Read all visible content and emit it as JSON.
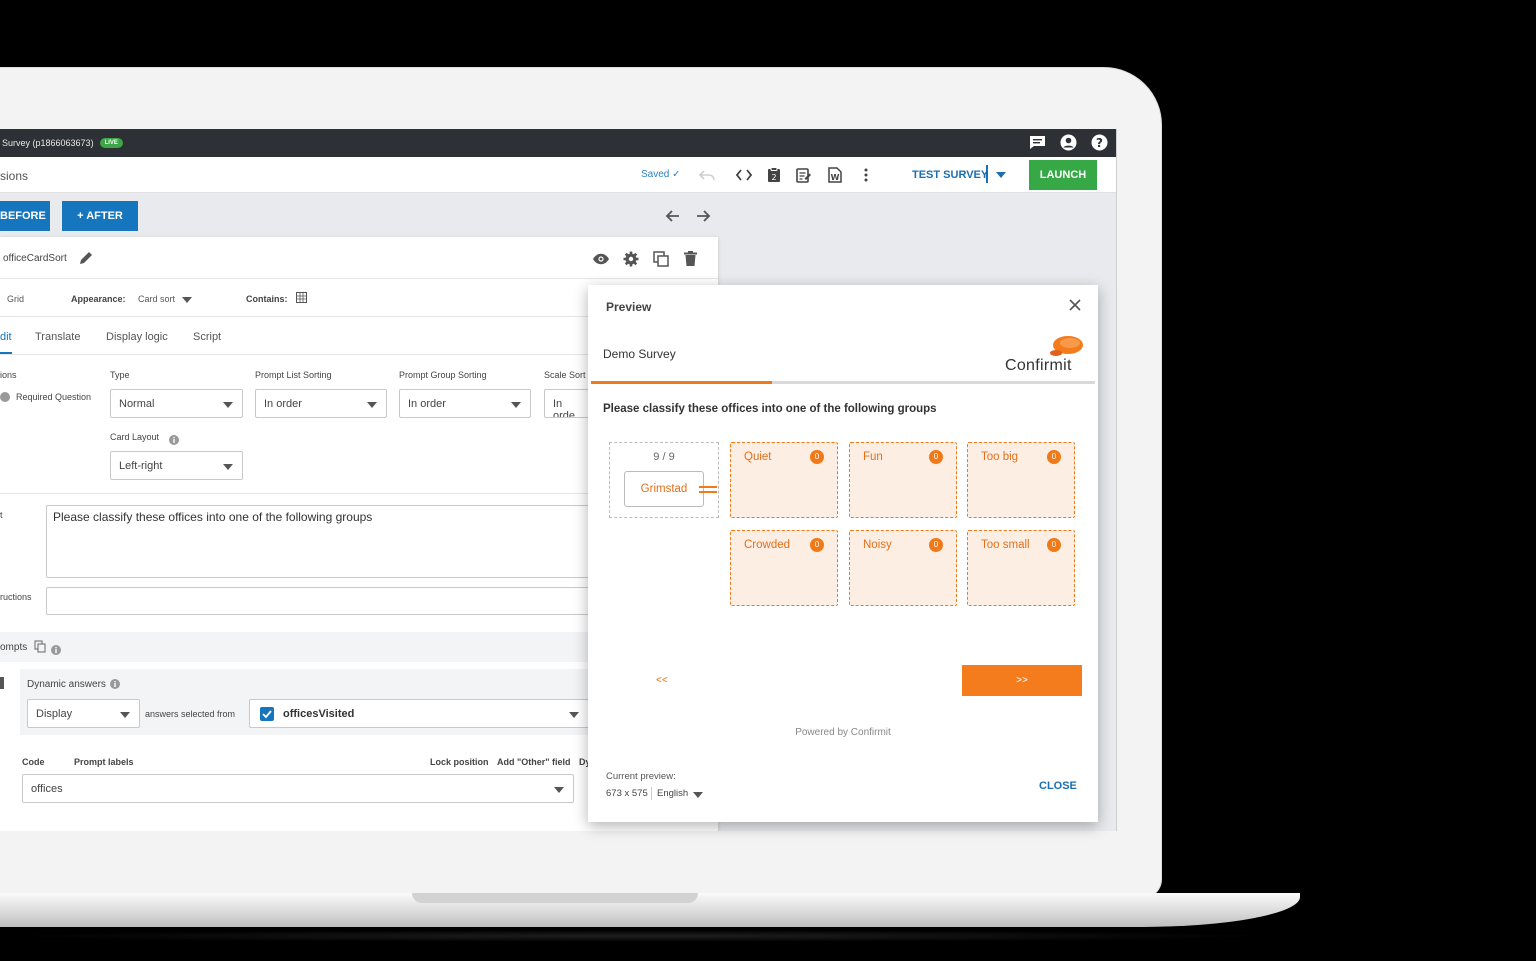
{
  "topbar": {
    "title": "Survey (p1866063673)",
    "live_badge": "LIVE",
    "icons": [
      "chat-icon",
      "account-icon",
      "help-icon"
    ]
  },
  "toolbar": {
    "breadcrumb": "sions",
    "saved_label": "Saved ✓",
    "icons": [
      "undo-icon",
      "code-icon",
      "clipboard-icon",
      "clipboard-edit-icon",
      "word-doc-icon",
      "more-vert-icon"
    ],
    "test_survey_label": "TEST SURVEY",
    "launch_label": "LAUNCH"
  },
  "actions": {
    "before_label": "BEFORE",
    "after_label": "+ AFTER"
  },
  "editor": {
    "question_name": "officeCardSort",
    "meta": {
      "type_value": "Grid",
      "appearance_label": "Appearance:",
      "appearance_value": "Card sort",
      "contains_label": "Contains:"
    },
    "tabs": [
      "dit",
      "Translate",
      "Display logic",
      "Script"
    ],
    "options_label": "ions",
    "required_label": "Required Question",
    "type_label": "Type",
    "type_value": "Normal",
    "prompt_list_sorting_label": "Prompt List Sorting",
    "prompt_list_sorting_value": "In order",
    "prompt_group_sorting_label": "Prompt Group Sorting",
    "prompt_group_sorting_value": "In order",
    "scale_sorting_label": "Scale Sort",
    "scale_sorting_value": "In orde",
    "card_layout_label": "Card Layout",
    "card_layout_value": "Left-right",
    "text_label": "t",
    "question_text": "Please classify these offices into one of the following groups",
    "instructions_label": "ructions",
    "prompts_label": "ompts",
    "dynamic_answers_label": "Dynamic answers",
    "display_value": "Display",
    "answers_selected_from": "answers selected from",
    "source_list": "officesVisited",
    "code_header": "Code",
    "prompt_labels_header": "Prompt labels",
    "lock_position_header": "Lock position",
    "add_other_header": "Add \"Other\" field",
    "dy_header": "Dy",
    "prompt_list_value": "offices"
  },
  "preview": {
    "title": "Preview",
    "survey_name": "Demo Survey",
    "brand": "Confirmit",
    "progress": 0.36,
    "question": "Please classify these offices into one of the following groups",
    "deck_count": "9 / 9",
    "current_card": "Grimstad",
    "groups": [
      {
        "label": "Quiet",
        "count": "0"
      },
      {
        "label": "Fun",
        "count": "0"
      },
      {
        "label": "Too big",
        "count": "0"
      },
      {
        "label": "Crowded",
        "count": "0"
      },
      {
        "label": "Noisy",
        "count": "0"
      },
      {
        "label": "Too small",
        "count": "0"
      }
    ],
    "prev_label": "<<",
    "next_label": ">>",
    "powered_by": "Powered by Confirmit",
    "current_preview_label": "Current preview:",
    "size": "673 x 575",
    "language": "English",
    "close_label": "CLOSE"
  },
  "colors": {
    "accent_blue": "#1576bd",
    "launch_green": "#36a845",
    "preview_orange": "#f07a1a"
  }
}
